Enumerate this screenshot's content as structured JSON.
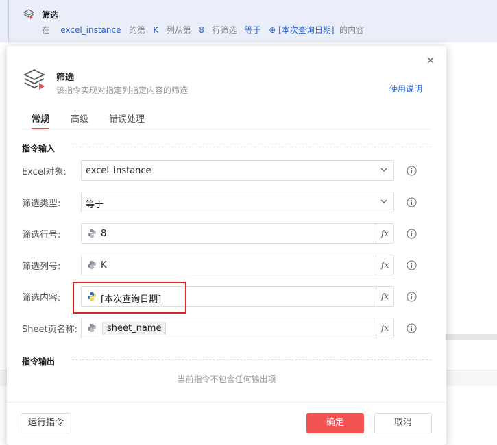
{
  "background": {
    "step_title": "筛选",
    "desc_prefix": "在",
    "desc_instance": "excel_instance",
    "desc_mid1": "的第",
    "desc_col": "K",
    "desc_mid2": "列从第",
    "desc_row": "8",
    "desc_mid3": "行筛选",
    "desc_op": "等于",
    "desc_value": "[本次查询日期]",
    "desc_suffix": "的内容"
  },
  "dialog": {
    "title": "筛选",
    "subtitle": "该指令实现对指定列指定内容的筛选",
    "help_link": "使用说明",
    "close_symbol": "×",
    "tabs": [
      "常规",
      "高级",
      "错误处理"
    ],
    "input_section": "指令输入",
    "output_section": "指令输出",
    "output_empty": "当前指令不包含任何输出项",
    "fields": {
      "excel_object": {
        "label": "Excel对象:",
        "value": "excel_instance"
      },
      "filter_type": {
        "label": "筛选类型:",
        "value": "等于"
      },
      "filter_row": {
        "label": "筛选行号:",
        "value": "8"
      },
      "filter_col": {
        "label": "筛选列号:",
        "value": "K"
      },
      "filter_content": {
        "label": "筛选内容:",
        "value": "[本次查询日期]"
      },
      "sheet_name": {
        "label": "Sheet页名称:",
        "value": "sheet_name"
      }
    },
    "fx_label": "fx",
    "buttons": {
      "run": "运行指令",
      "ok": "确定",
      "cancel": "取消"
    }
  },
  "colors": {
    "accent": "#f25454",
    "link": "#2a62d6",
    "highlight_box": "#e02020"
  },
  "icons": [
    "layers-icon",
    "python-icon",
    "chevron-down-icon",
    "info-icon",
    "close-icon",
    "fx-icon"
  ]
}
